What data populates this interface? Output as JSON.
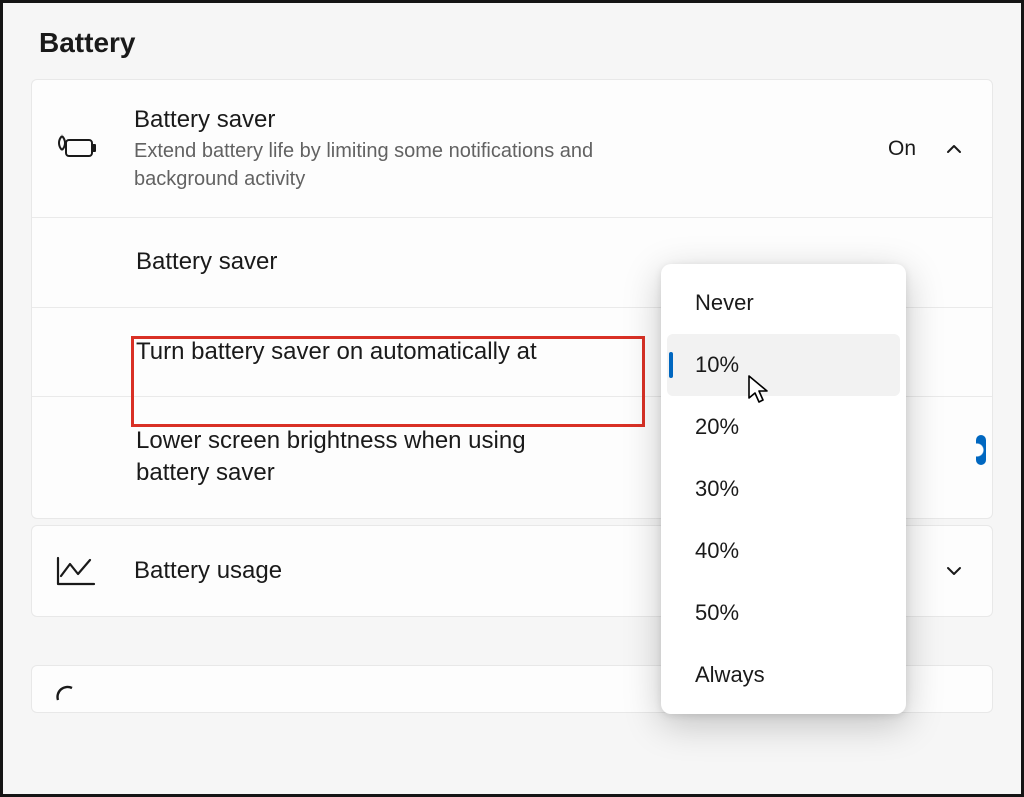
{
  "section": {
    "title": "Battery"
  },
  "batterySaver": {
    "title": "Battery saver",
    "description": "Extend battery life by limiting some notifications and background activity",
    "status": "On",
    "rows": {
      "saver": {
        "label": "Battery saver"
      },
      "autoAt": {
        "label": "Turn battery saver on automatically at"
      },
      "brightness": {
        "label": "Lower screen brightness when using battery saver"
      }
    }
  },
  "batteryUsage": {
    "title": "Battery usage"
  },
  "dropdown": {
    "options": [
      {
        "label": "Never"
      },
      {
        "label": "10%"
      },
      {
        "label": "20%"
      },
      {
        "label": "30%"
      },
      {
        "label": "40%"
      },
      {
        "label": "50%"
      },
      {
        "label": "Always"
      }
    ],
    "selectedIndex": 1
  }
}
